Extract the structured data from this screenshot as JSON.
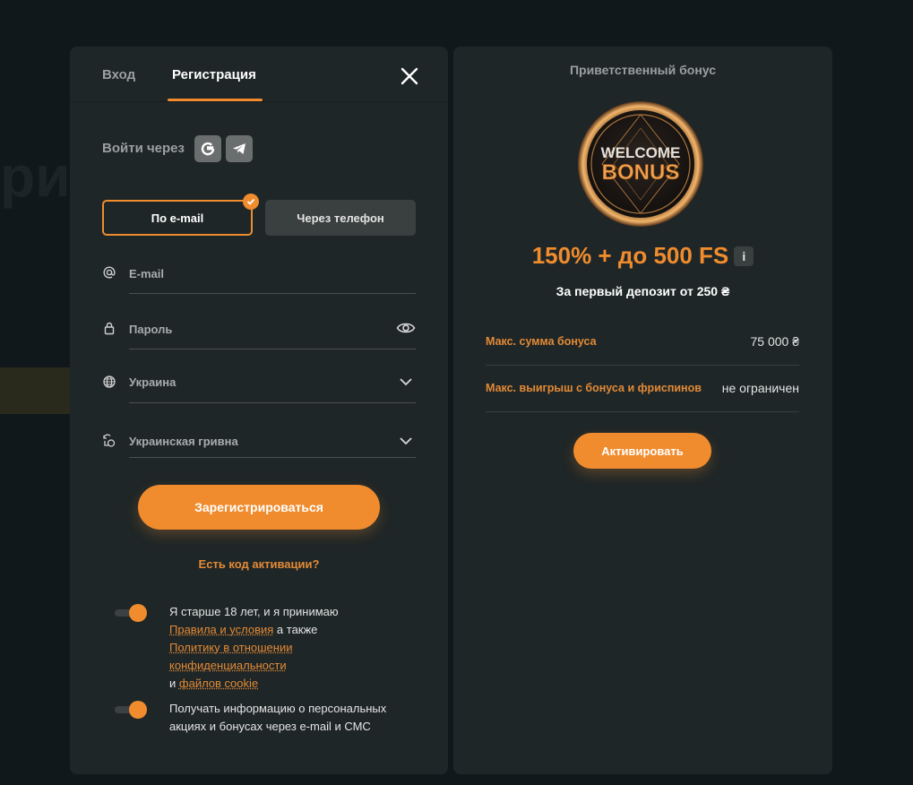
{
  "tabs": {
    "login": "Вход",
    "register": "Регистрация"
  },
  "social": {
    "label": "Войти через",
    "google_icon": "google-icon",
    "telegram_icon": "telegram-icon"
  },
  "modes": {
    "email": "По e-mail",
    "phone": "Через телефон"
  },
  "fields": {
    "email_placeholder": "E-mail",
    "password_placeholder": "Пароль",
    "country": "Украина",
    "currency": "Украинская гривна"
  },
  "register_button": "Зарегистрироваться",
  "promo_link": "Есть код активации?",
  "consent": {
    "age_prefix": "Я старше 18 лет, и я принимаю",
    "terms_link": "Правила и условия",
    "also": "а также",
    "privacy_link": "Политику в отношении конфиденциальности",
    "and": "и",
    "cookie_link": "файлов cookie",
    "marketing": "Получать информацию о персональных акциях и бонусах через e-mail и СМС"
  },
  "bonus": {
    "heading": "Приветственный бонус",
    "coin_line1": "WELCOME",
    "coin_line2": "BONUS",
    "amount": "150% + до 500 FS",
    "info": "i",
    "subtitle": "За первый депозит от 250 ₴",
    "rows": [
      {
        "label": "Макс. сумма бонуса",
        "value": "75 000 ₴"
      },
      {
        "label": "Макс. выигрыш с бонуса и фриспинов",
        "value": "не ограничен"
      }
    ],
    "activate": "Активировать"
  },
  "colors": {
    "accent": "#f08c2e",
    "panel": "#1f2627",
    "background": "#10181b"
  }
}
